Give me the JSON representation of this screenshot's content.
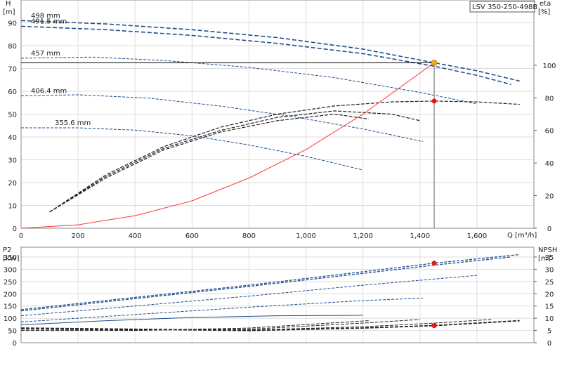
{
  "chart_data": [
    {
      "type": "line",
      "title": "LSV 350-250-498B",
      "xlabel": "Q [m³/h]",
      "ylabel_left_name": "H",
      "ylabel_left_unit": "[m]",
      "ylabel_right_name": "eta",
      "ylabel_right_unit": "[%]",
      "xlim": [
        0,
        1800
      ],
      "ylim_left": [
        0,
        100
      ],
      "ylim_right": [
        0,
        140
      ],
      "grid": true,
      "x_ticks": [
        0,
        200,
        400,
        600,
        800,
        1000,
        1200,
        1400,
        1600
      ],
      "x_tick_labels": [
        "0",
        "200",
        "400",
        "600",
        "800",
        "1,000",
        "1,200",
        "1,400",
        "1,600"
      ],
      "y_left_ticks": [
        0,
        10,
        20,
        30,
        40,
        50,
        60,
        70,
        80,
        90
      ],
      "y_left_tick_labels": [
        "0",
        "10",
        "20",
        "30",
        "40",
        "50",
        "60",
        "70",
        "80",
        "90"
      ],
      "y_right_ticks": [
        0,
        20,
        40,
        60,
        80,
        100
      ],
      "y_right_tick_labels": [
        "0",
        "20",
        "40",
        "60",
        "80",
        "100"
      ],
      "head_curves": [
        {
          "name": "498 mm",
          "color": "#1f4e8c",
          "x": [
            0,
            300,
            600,
            900,
            1200,
            1450,
            1600,
            1750
          ],
          "y": [
            91,
            89.5,
            87,
            83.5,
            78.5,
            72.5,
            69,
            64.5
          ]
        },
        {
          "name": "491.5 mm",
          "color": "#1f4e8c",
          "x": [
            0,
            300,
            600,
            900,
            1200,
            1450,
            1600,
            1720
          ],
          "y": [
            88.5,
            87,
            84.5,
            81,
            76.5,
            71,
            67,
            63
          ]
        },
        {
          "name": "457 mm",
          "color": "#1f4e8c",
          "x": [
            0,
            250,
            500,
            800,
            1100,
            1400,
            1600
          ],
          "y": [
            74.5,
            75,
            73.5,
            70.5,
            66,
            59.5,
            54.5
          ]
        },
        {
          "name": "406.4 mm",
          "color": "#1f4e8c",
          "x": [
            0,
            200,
            450,
            700,
            950,
            1200,
            1410
          ],
          "y": [
            58,
            58.5,
            57,
            53.5,
            49,
            43.5,
            38
          ]
        },
        {
          "name": "355.6 mm",
          "color": "#1f4e8c",
          "x": [
            0,
            200,
            400,
            600,
            800,
            1000,
            1200
          ],
          "y": [
            44,
            44,
            43,
            40.5,
            36.5,
            31.5,
            25.5
          ]
        }
      ],
      "efficiency_curves": [
        {
          "color": "#222222",
          "x": [
            100,
            300,
            500,
            700,
            900,
            1100,
            1300,
            1450,
            1600,
            1750
          ],
          "y": [
            10,
            33,
            50,
            62,
            70,
            75,
            77.5,
            78,
            77.5,
            76
          ]
        },
        {
          "color": "#222222",
          "x": [
            100,
            300,
            500,
            700,
            900,
            1100,
            1300,
            1400
          ],
          "y": [
            10,
            32,
            49,
            60,
            68,
            72,
            70,
            66
          ]
        },
        {
          "color": "#222222",
          "x": [
            100,
            300,
            500,
            700,
            900,
            1100,
            1220
          ],
          "y": [
            10,
            31,
            48,
            59,
            66,
            70,
            67
          ]
        }
      ],
      "system_curve": {
        "color": "#ff3333",
        "x": [
          0,
          200,
          400,
          600,
          800,
          1000,
          1200,
          1450
        ],
        "y": [
          0,
          1.5,
          5.5,
          12,
          22,
          34.5,
          50,
          72.5
        ]
      },
      "operating_point_head": {
        "x": 1450,
        "y": 72.5,
        "color": "#f5a623"
      },
      "operating_point_eta": {
        "x": 1450,
        "y": 78,
        "color": "#ee1111"
      }
    },
    {
      "type": "line",
      "ylabel_left_name": "P2",
      "ylabel_left_unit": "[kW]",
      "ylabel_right_name": "NPSH",
      "ylabel_right_unit": "[m]",
      "xlim": [
        0,
        1800
      ],
      "ylim_left": [
        0,
        390
      ],
      "ylim_right": [
        0,
        39
      ],
      "grid": true,
      "y_left_ticks": [
        0,
        50,
        100,
        150,
        200,
        250,
        300,
        350
      ],
      "y_left_tick_labels": [
        "0",
        "50",
        "100",
        "150",
        "200",
        "250",
        "300",
        "350"
      ],
      "y_right_ticks": [
        0,
        5,
        10,
        15,
        20,
        25,
        30,
        35
      ],
      "y_right_tick_labels": [
        "0",
        "5",
        "10",
        "15",
        "20",
        "25",
        "30",
        "35"
      ],
      "power_curves": [
        {
          "color": "#1f4e8c",
          "x": [
            0,
            400,
            800,
            1200,
            1450,
            1750
          ],
          "y": [
            135,
            185,
            235,
            290,
            325,
            360
          ]
        },
        {
          "color": "#1f4e8c",
          "x": [
            0,
            400,
            800,
            1200,
            1450,
            1720
          ],
          "y": [
            130,
            180,
            230,
            283,
            317,
            350
          ]
        },
        {
          "color": "#1f4e8c",
          "x": [
            0,
            400,
            800,
            1200,
            1600
          ],
          "y": [
            110,
            150,
            190,
            235,
            275
          ]
        },
        {
          "color": "#1f4e8c",
          "x": [
            0,
            400,
            800,
            1200,
            1410
          ],
          "y": [
            85,
            115,
            145,
            172,
            182
          ]
        },
        {
          "color": "#1f4e8c",
          "x": [
            0,
            300,
            600,
            900,
            1200
          ],
          "y": [
            73,
            90,
            103,
            110,
            112
          ]
        }
      ],
      "npsh_curves": [
        {
          "color": "#222222",
          "x": [
            0,
            400,
            800,
            1200,
            1450,
            1750
          ],
          "y": [
            6,
            5.5,
            5,
            6,
            7,
            9
          ]
        },
        {
          "color": "#222222",
          "x": [
            0,
            400,
            800,
            1200,
            1450,
            1650
          ],
          "y": [
            6,
            5.5,
            5.2,
            6.5,
            8,
            9.5
          ]
        },
        {
          "color": "#222222",
          "x": [
            0,
            400,
            800,
            1200,
            1400
          ],
          "y": [
            5.5,
            5.2,
            5.5,
            8,
            9.5
          ]
        },
        {
          "color": "#222222",
          "x": [
            0,
            400,
            800,
            1220
          ],
          "y": [
            5,
            5,
            6,
            9
          ]
        }
      ],
      "operating_point_power": {
        "x": 1450,
        "y": 325,
        "color": "#ee1111"
      },
      "operating_point_npsh": {
        "x": 1450,
        "y": 7,
        "color": "#ee1111"
      }
    }
  ]
}
